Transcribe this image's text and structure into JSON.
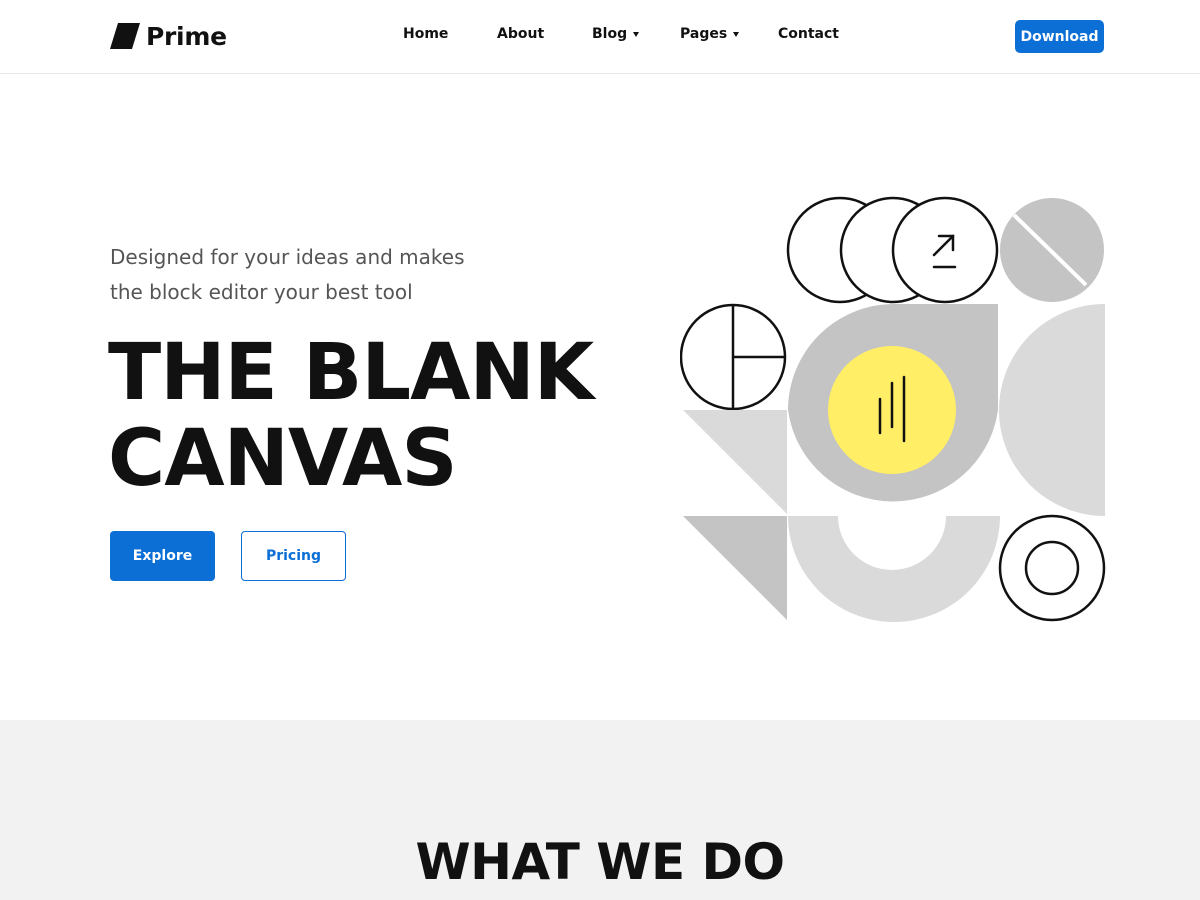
{
  "header": {
    "brand": "Prime",
    "nav": [
      {
        "label": "Home"
      },
      {
        "label": "About"
      },
      {
        "label": "Blog",
        "dropdown": true
      },
      {
        "label": "Pages",
        "dropdown": true
      },
      {
        "label": "Contact"
      }
    ],
    "cta_label": "Download"
  },
  "hero": {
    "subtitle_line1": "Designed for your ideas and makes",
    "subtitle_line2": "the block editor your best tool",
    "title_line1": "THE BLANK",
    "title_line2": "CANVAS",
    "primary_button": "Explore",
    "secondary_button": "Pricing"
  },
  "section": {
    "title": "WHAT WE DO"
  },
  "colors": {
    "accent": "#0b6fd6",
    "highlight_yellow": "#ffee66",
    "shape_grey": "#c4c4c4",
    "shape_light_grey": "#dadada",
    "band_background": "#f2f2f2"
  },
  "icons": {
    "logo": "parallelogram-logo-icon",
    "arrow": "arrow-up-right-icon",
    "caret": "caret-down-icon"
  }
}
